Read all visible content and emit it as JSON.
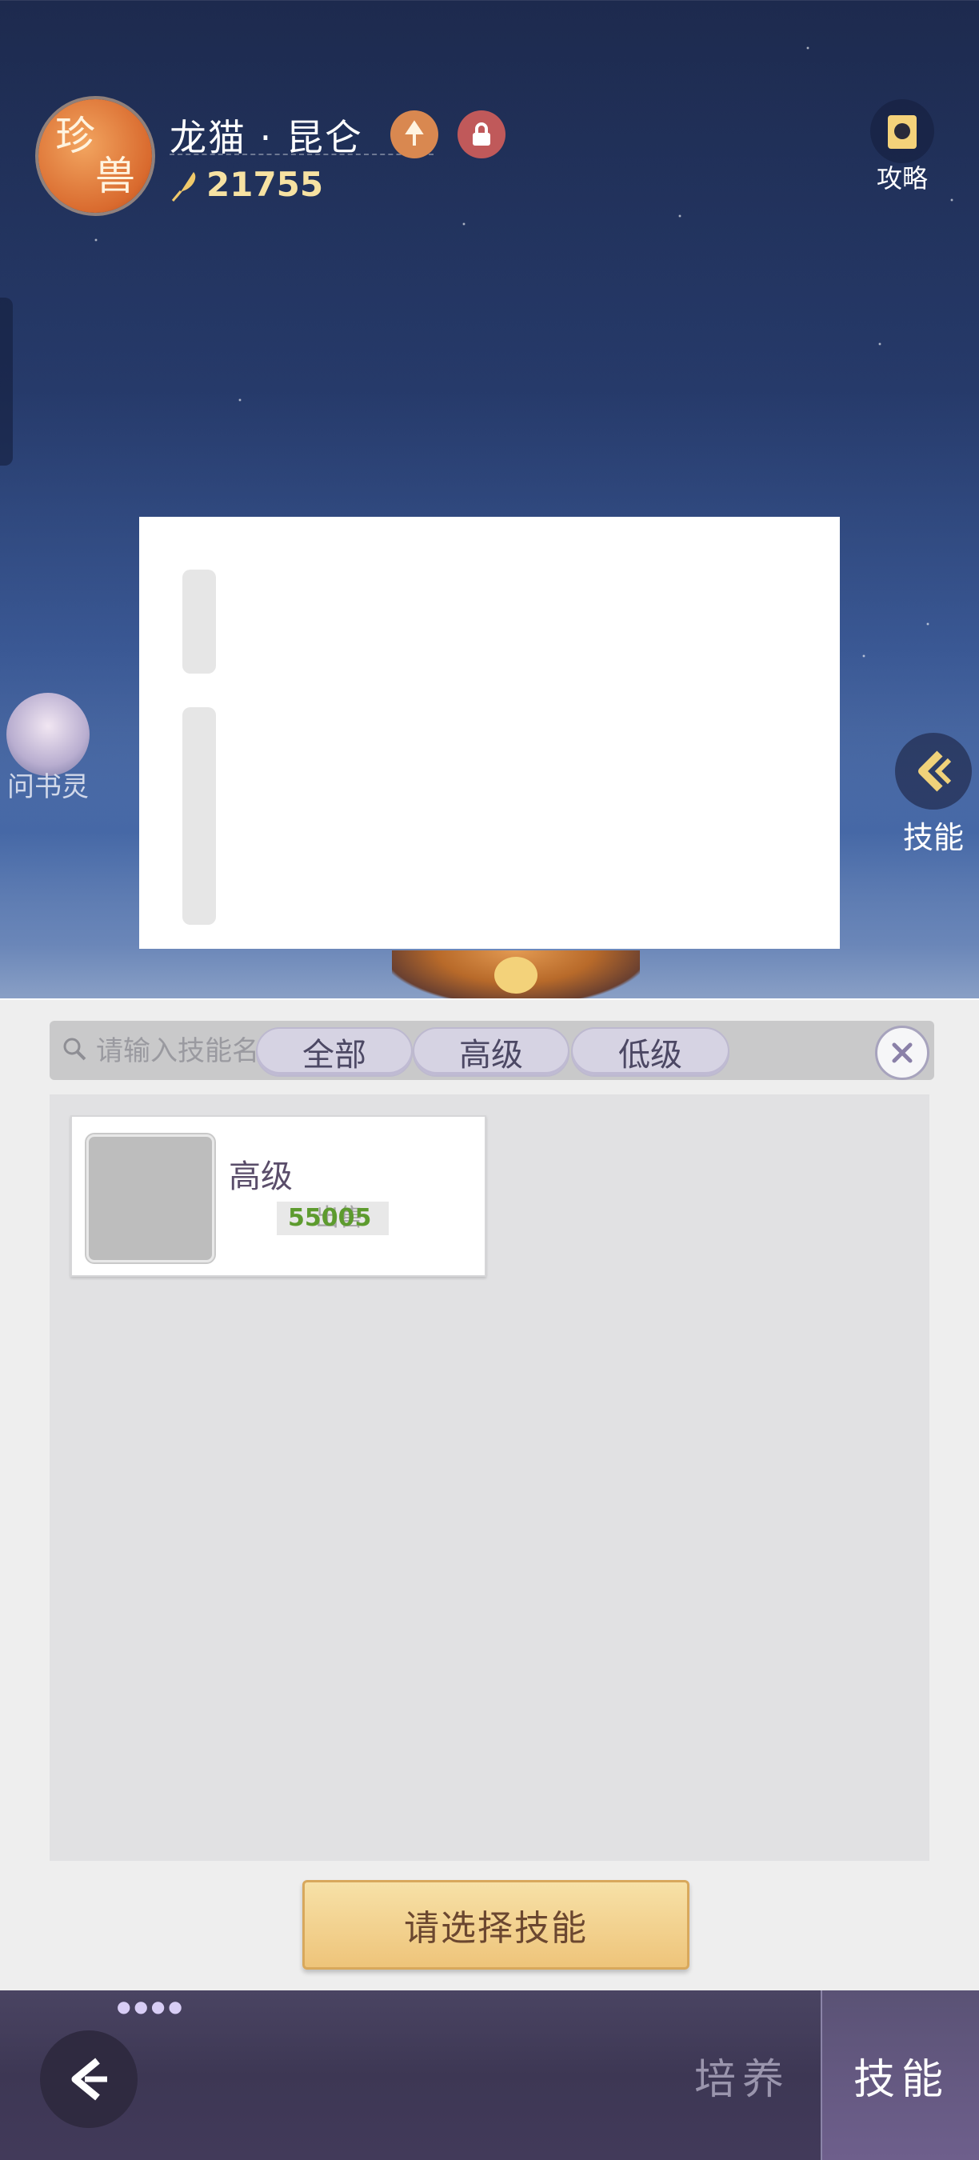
{
  "header": {
    "badge_line1": "珍",
    "badge_line2": "兽",
    "pet_name": "龙猫 · 昆仑",
    "power": "21755",
    "guide_label": "攻略"
  },
  "side": {
    "helper_label": "问书灵",
    "skill_label": "技能"
  },
  "search": {
    "placeholder": "请输入技能名称"
  },
  "filters": {
    "all": "全部",
    "high": "高级",
    "low": "低级"
  },
  "skill_list": [
    {
      "grade": "高级",
      "price": "55005",
      "status": "出售"
    }
  ],
  "confirm_button": "请选择技能",
  "bottom_tabs": {
    "train": "培养",
    "skill": "技能"
  },
  "colors": {
    "accent_gold": "#eec47a",
    "price_green": "#5d9b2e",
    "panel_bg": "#eeeeee"
  }
}
